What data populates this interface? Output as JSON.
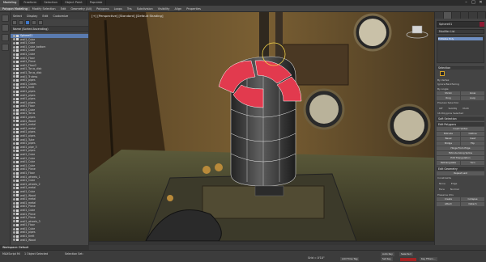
{
  "titlebar": {
    "tabs": [
      "Modeling",
      "Freeform",
      "Selection",
      "Object Paint",
      "Populate"
    ],
    "active_tab": 0,
    "window_buttons": [
      "–",
      "□",
      "✕"
    ]
  },
  "ribbon": {
    "items": [
      "Polygon Modeling",
      "Modify Selection",
      "Edit",
      "Geometry (All)",
      "Polygons",
      "Loops",
      "Tris",
      "Subdivision",
      "Visibility",
      "Align",
      "Properties"
    ]
  },
  "scene_explorer": {
    "menu": [
      "Select",
      "Display",
      "Edit",
      "Customize"
    ],
    "header": "Name (Sorted Ascending)",
    "items": [
      "Sphere01",
      "wall1_Cube",
      "wall1_Cube",
      "wall1_Cube_bottom",
      "wall1_Cube",
      "wall1_Cube",
      "wall1_Floor",
      "wall1_Plane",
      "wall1_Floor2",
      "wall1_Torus_disk",
      "wall1_Torus_disk",
      "wall1_Trutess",
      "wall1_pipes",
      "wall1_Cubes",
      "wall1_tirelt",
      "wall1_pipes",
      "wall1_pipes",
      "wall1_pipes",
      "wall1_pipes",
      "wall1_Floor",
      "wall1_Cube",
      "wall1_Torus",
      "wall1_pipes",
      "wall1_Wood",
      "wall1_metal",
      "wall1_metal",
      "wall1_pipes",
      "wall1_pipes",
      "wall1_Tube",
      "wall1_pipes",
      "wall1_pipe_3",
      "wall1_pipes",
      "wall1_Cube",
      "wall1_Cube",
      "wall1_Cube",
      "wall1_Cube",
      "wall1_Plane",
      "wall1_Floor",
      "wall1_wheels_1",
      "wall1_Cube",
      "wall1_wheels_2",
      "wall1_metal",
      "wall1_Cube",
      "wall1_Wood",
      "wall1_metal",
      "wall1_metal",
      "wall1_Plane",
      "wall1_Cube",
      "wall1_Plane",
      "wall1_Plane",
      "wall1_wheels_3",
      "wall1_Floor",
      "wall1_Cube",
      "wall1_pipes",
      "wall1_tirelt",
      "wall1_Wood"
    ],
    "selected_index": 0
  },
  "viewport": {
    "label": "[+] [Perspective] [Standard] [Default Shading]"
  },
  "command_panel": {
    "object_name": "Sphere01",
    "object_color": "#8e1a33",
    "modifier_list": "Modifier List",
    "modifier": "Editable Poly",
    "rollouts": [
      "Selection",
      "Soft Selection",
      "Edit Polygons",
      "Edit Geometry",
      "Polygon: Material IDs",
      "Subdivision Surface"
    ],
    "selection_options": [
      "By Vertex",
      "Ignore Backfacing",
      "By Angle:"
    ],
    "shrink_grow": [
      "Shrink",
      "Grow"
    ],
    "ring_loop": [
      "Ring",
      "Loop"
    ],
    "preview_selection": "Preview Selection",
    "preview_options": [
      "Off",
      "SubObj",
      "Multi"
    ],
    "selected_count": "16 Polygons Selected",
    "insert_vertex": "Insert Vertex",
    "edit_buttons": [
      [
        "Extrude",
        "Outline"
      ],
      [
        "Bevel",
        "Inset"
      ],
      [
        "Bridge",
        "Flip"
      ],
      [
        "Hinge From Edge"
      ],
      [
        "Extrude Along Spline"
      ],
      [
        "Edit Triangulation"
      ],
      [
        "Retriangulate",
        "Turn"
      ]
    ],
    "repeat_last": "Repeat Last",
    "constraints": "Constraints",
    "constraint_opts": [
      "None",
      "Edge",
      "Face",
      "Normal"
    ],
    "preserve_uvs": "Preserve UVs",
    "create_collapse": [
      "Create",
      "Collapse"
    ],
    "attach_detach": [
      "Attach",
      "Detach"
    ]
  },
  "workspace": {
    "label": "Workspace: Default"
  },
  "status_bar": {
    "selection_info": "1 Object Selected",
    "selection_set": "Selection Set:",
    "grid": "Grid = 0'10\"",
    "add_time_tag": "Add Time Tag",
    "auto_key": "Auto Key",
    "selected": "Selected",
    "set_key": "Set Key",
    "key_filters": "Key Filters...",
    "script_hint": "MAXScript Mi"
  }
}
